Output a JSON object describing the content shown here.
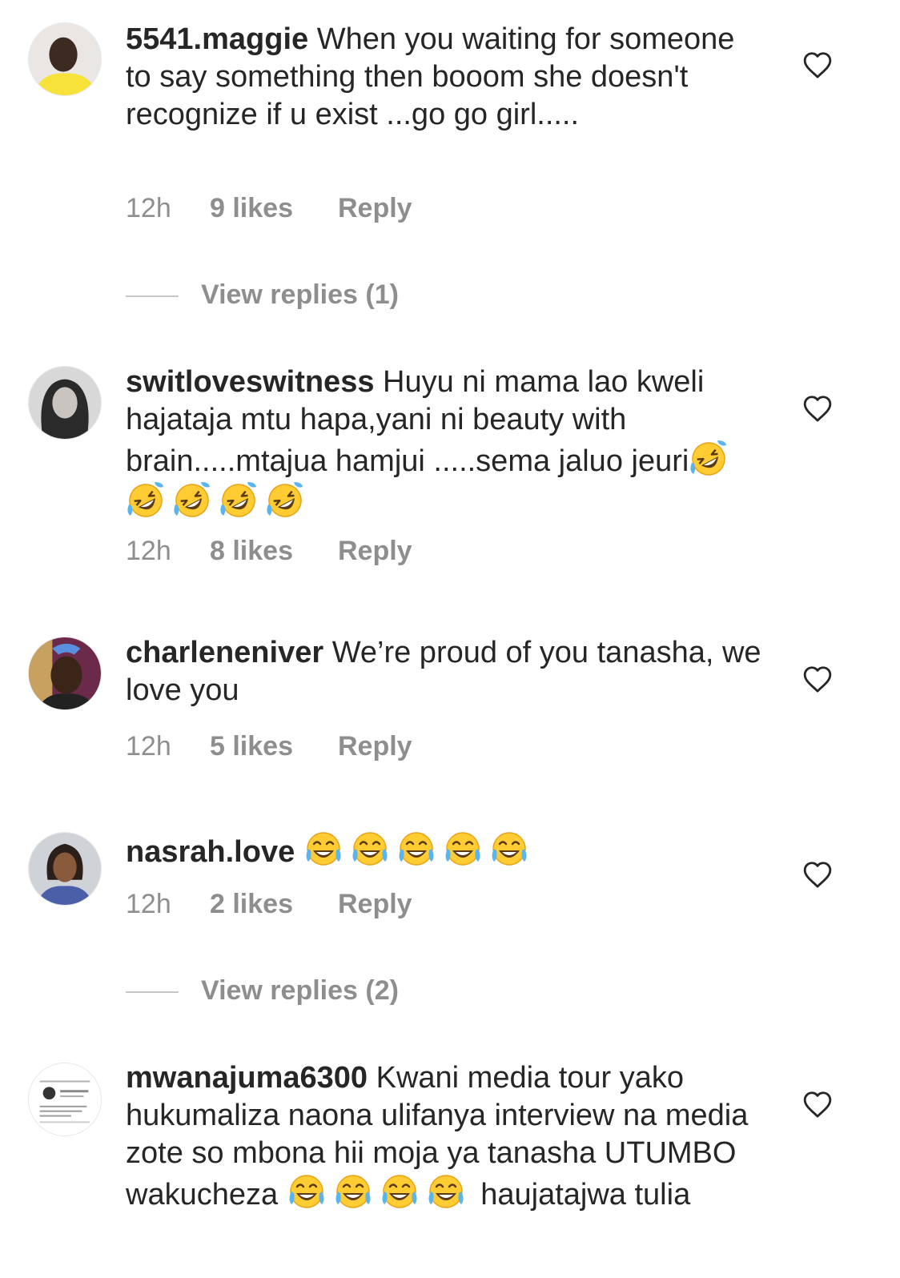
{
  "comments": [
    {
      "username": "5541.maggie",
      "text": "When you waiting for someone to say something then booom she doesn't recognize if u exist ...go go girl.....",
      "time": "12h",
      "likes": "9 likes",
      "reply": "Reply",
      "view_replies": "View replies (1)",
      "avatar_color": "#f7e23a"
    },
    {
      "username": "switloveswitness",
      "text": "Huyu ni mama lao kweli hajataja mtu hapa,yani ni beauty with brain.....mtajua hamjui .....sema jaluo jeuri",
      "emoji": "rolling-on-floor-laughing",
      "time": "12h",
      "likes": "8 likes",
      "reply": "Reply"
    },
    {
      "username": "charleneniver",
      "text": "We’re proud of you tanasha, we love you",
      "time": "12h",
      "likes": "5 likes",
      "reply": "Reply"
    },
    {
      "username": "nasrah.love",
      "emoji": "face-with-tears-of-joy",
      "time": "12h",
      "likes": "2 likes",
      "reply": "Reply",
      "view_replies": "View replies (2)"
    },
    {
      "username": "mwanajuma6300",
      "text": "Kwani media tour yako hukumaliza naona ulifanya interview na media zote so mbona hii moja ya tanasha UTUMBO wakucheza",
      "text_after_emoji": "haujatajwa tulia",
      "emoji": "face-with-tears-of-joy"
    }
  ],
  "colors": {
    "text": "#262626",
    "meta": "#8e8e8e",
    "divider": "#c7c7c7"
  }
}
